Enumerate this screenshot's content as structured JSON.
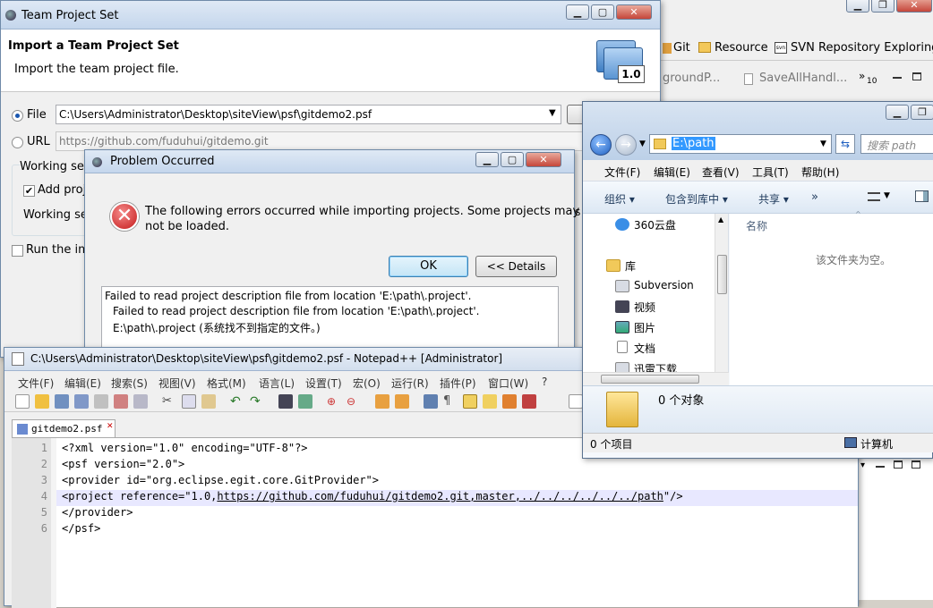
{
  "background_eclipse": {
    "toolbar_items": [
      "Git",
      "Resource",
      "SVN Repository Exploring"
    ],
    "editor_tabs": [
      "groundP...",
      "SaveAllHandl..."
    ],
    "overflow_count": "10"
  },
  "team_project_set": {
    "window_title": "Team Project Set",
    "heading": "Import a Team Project Set",
    "subheading": "Import the team project file.",
    "file_label": "File",
    "file_value": "C:\\Users\\Administrator\\Desktop\\siteView\\psf\\gitdemo2.psf",
    "url_label": "URL",
    "url_value": "https://github.com/fuduhui/gitdemo.git",
    "working_sets_label": "Working set",
    "add_project_label": "Add proj",
    "working_sets_field_label": "Working se",
    "run_label": "Run the imp"
  },
  "problem_dialog": {
    "title": "Problem Occurred",
    "message_line1": "The following errors occurred while importing projects. Some projects may",
    "message_line2": "not be loaded.",
    "ok_label": "OK",
    "details_label": "<< Details",
    "detail_line1": "Failed to read project description file from location 'E:\\path\\.project'.",
    "detail_line2": "Failed to read project description file from location 'E:\\path\\.project'.",
    "detail_line3": "E:\\path\\.project (系统找不到指定的文件。)"
  },
  "notepad": {
    "title": "C:\\Users\\Administrator\\Desktop\\siteView\\psf\\gitdemo2.psf - Notepad++ [Administrator]",
    "menu": [
      "文件(F)",
      "编辑(E)",
      "搜索(S)",
      "视图(V)",
      "格式(M)",
      "语言(L)",
      "设置(T)",
      "宏(O)",
      "运行(R)",
      "插件(P)",
      "窗口(W)",
      "?"
    ],
    "tab_label": "gitdemo2.psf",
    "lines": [
      {
        "n": "1",
        "text": "<?xml version=\"1.0\" encoding=\"UTF-8\"?>"
      },
      {
        "n": "2",
        "text": "<psf version=\"2.0\">"
      },
      {
        "n": "3",
        "text": "<provider id=\"org.eclipse.egit.core.GitProvider\">"
      },
      {
        "n": "4",
        "text": "<project reference=\"1.0,",
        "link": "https://github.com/fuduhui/gitdemo2.git,master,../../../../../../path",
        "tail": "\"/>"
      },
      {
        "n": "5",
        "text": "</provider>"
      },
      {
        "n": "6",
        "text": "</psf>"
      }
    ]
  },
  "explorer": {
    "address": "E:\\path",
    "search_placeholder": "搜索 path",
    "menu": [
      "文件(F)",
      "编辑(E)",
      "查看(V)",
      "工具(T)",
      "帮助(H)"
    ],
    "toolbar": [
      "组织 ▾",
      "包含到库中 ▾",
      "共享 ▾",
      "»"
    ],
    "nav_items": [
      "360云盘",
      "库",
      "Subversion",
      "视频",
      "图片",
      "文档",
      "迅雷下载"
    ],
    "column_name": "名称",
    "empty_message": "该文件夹为空。",
    "details_count": "0 个对象",
    "status_left": "0 个项目",
    "status_right": "计算机"
  },
  "colors": {
    "titlebar_top": "#dfe9f5",
    "error_red": "#cc2222",
    "link_blue": "#1a4fa0",
    "selection": "#3399ff"
  }
}
